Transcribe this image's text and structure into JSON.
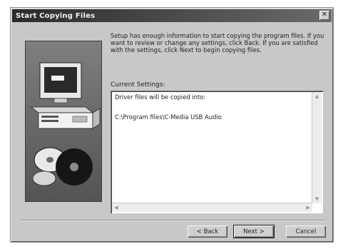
{
  "window": {
    "title": "Start Copying Files",
    "close_glyph": "✕"
  },
  "intro_text": "Setup has enough information to start copying the program files. If you want to review or change any settings, click Back. If you are satisfied with the settings, click Next to begin copying files.",
  "settings": {
    "label": "Current Settings:",
    "lines": [
      "Driver files will be copied into:",
      "C:\\Program files\\C-Media USB Audio"
    ]
  },
  "buttons": {
    "back": "< Back",
    "next": "Next >",
    "cancel": "Cancel"
  },
  "icons": {
    "art": "computer-and-cd-illustration",
    "close": "close-icon",
    "scroll_up": "chevron-up-icon",
    "scroll_down": "chevron-down-icon",
    "scroll_left": "chevron-left-icon",
    "scroll_right": "chevron-right-icon"
  }
}
